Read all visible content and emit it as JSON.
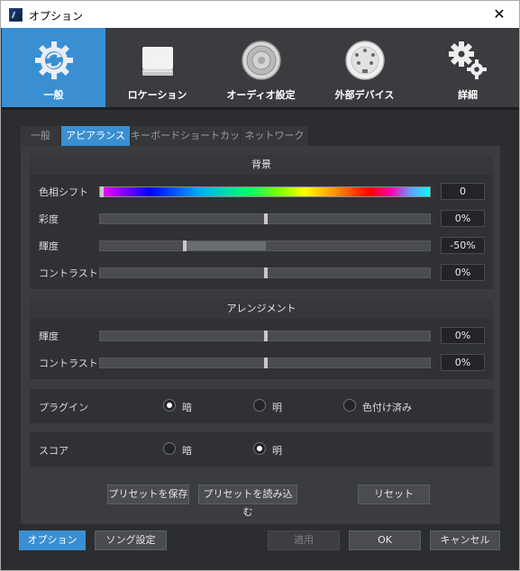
{
  "window": {
    "title": "オプション",
    "close_glyph": "✕"
  },
  "categories": [
    {
      "label": "一般",
      "icon": "sync-gear-icon",
      "active": true
    },
    {
      "label": "ロケーション",
      "icon": "drive-icon",
      "active": false
    },
    {
      "label": "オーディオ設定",
      "icon": "speaker-icon",
      "active": false
    },
    {
      "label": "外部デバイス",
      "icon": "midi-port-icon",
      "active": false
    },
    {
      "label": "詳細",
      "icon": "gears-icon",
      "active": false
    }
  ],
  "subtabs": [
    {
      "label": "一般",
      "active": false
    },
    {
      "label": "アピアランス",
      "active": true
    },
    {
      "label": "キーボードショートカット",
      "active": false
    },
    {
      "label": "ネットワーク",
      "active": false
    }
  ],
  "background_section": {
    "title": "背景",
    "rows": [
      {
        "label": "色相シフト",
        "value": "0"
      },
      {
        "label": "彩度",
        "value": "0%"
      },
      {
        "label": "輝度",
        "value": "-50%"
      },
      {
        "label": "コントラスト",
        "value": "0%"
      }
    ]
  },
  "arrangement_section": {
    "title": "アレンジメント",
    "rows": [
      {
        "label": "輝度",
        "value": "0%"
      },
      {
        "label": "コントラスト",
        "value": "0%"
      }
    ]
  },
  "plugin": {
    "label": "プラグイン",
    "options": [
      {
        "label": "暗",
        "selected": true
      },
      {
        "label": "明",
        "selected": false
      },
      {
        "label": "色付け済み",
        "selected": false
      }
    ]
  },
  "score": {
    "label": "スコア",
    "options": [
      {
        "label": "暗",
        "selected": false
      },
      {
        "label": "明",
        "selected": true
      }
    ]
  },
  "preset_buttons": {
    "save": "プリセットを保存",
    "load": "プリセットを読み込む",
    "reset": "リセット"
  },
  "footer": {
    "options": "オプション",
    "song_settings": "ソング設定",
    "apply": "適用",
    "ok": "OK",
    "cancel": "キャンセル"
  },
  "colors": {
    "accent": "#3a8fd3",
    "background": "#2b2d30"
  }
}
